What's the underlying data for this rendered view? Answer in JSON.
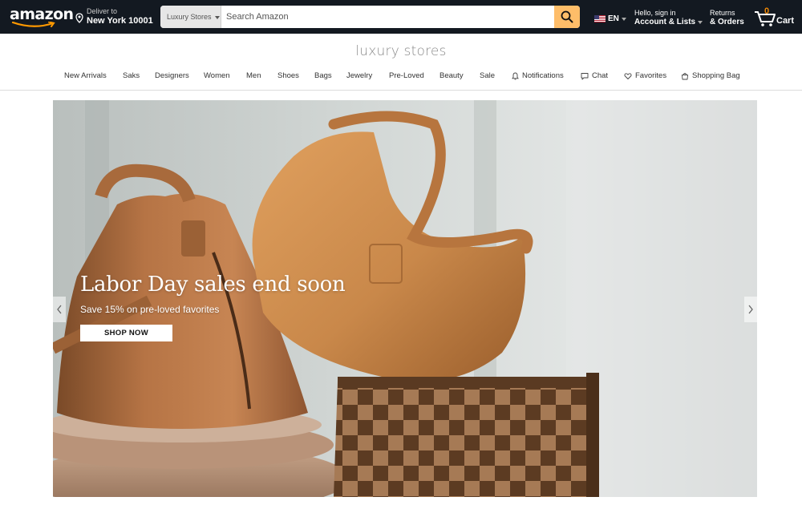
{
  "topnav": {
    "logo": "amazon",
    "deliver": {
      "line1": "Deliver to",
      "line2": "New York 10001",
      "icon": "location-pin-icon"
    },
    "search": {
      "category": "Luxury Stores",
      "placeholder": "Search Amazon",
      "icon": "search-icon"
    },
    "language": "EN",
    "account": {
      "line1": "Hello, sign in",
      "line2": "Account & Lists"
    },
    "orders": {
      "line1": "Returns",
      "line2": "& Orders"
    },
    "cart": {
      "count": "0",
      "label": "Cart",
      "icon": "cart-icon"
    }
  },
  "store": {
    "title": "luxury stores",
    "nav": [
      {
        "label": "New Arrivals"
      },
      {
        "label": "Saks"
      },
      {
        "label": "Designers"
      },
      {
        "label": "Women"
      },
      {
        "label": "Men"
      },
      {
        "label": "Shoes"
      },
      {
        "label": "Bags"
      },
      {
        "label": "Jewelry"
      },
      {
        "label": "Pre-Loved"
      },
      {
        "label": "Beauty"
      },
      {
        "label": "Sale"
      },
      {
        "label": "Notifications",
        "icon": "bell-icon"
      },
      {
        "label": "Chat",
        "icon": "chat-icon"
      },
      {
        "label": "Favorites",
        "icon": "heart-icon"
      },
      {
        "label": "Shopping Bag",
        "icon": "shopping-bag-icon"
      }
    ]
  },
  "hero": {
    "headline": "Labor Day sales end soon",
    "subtext": "Save 15% on pre-loved favorites",
    "cta": "SHOP NOW"
  },
  "colors": {
    "nav_bg": "#131921",
    "search_button": "#febd69",
    "cart_count": "#f08804",
    "bag_tan": "#c8894e",
    "bag_brown": "#8b5a36"
  }
}
